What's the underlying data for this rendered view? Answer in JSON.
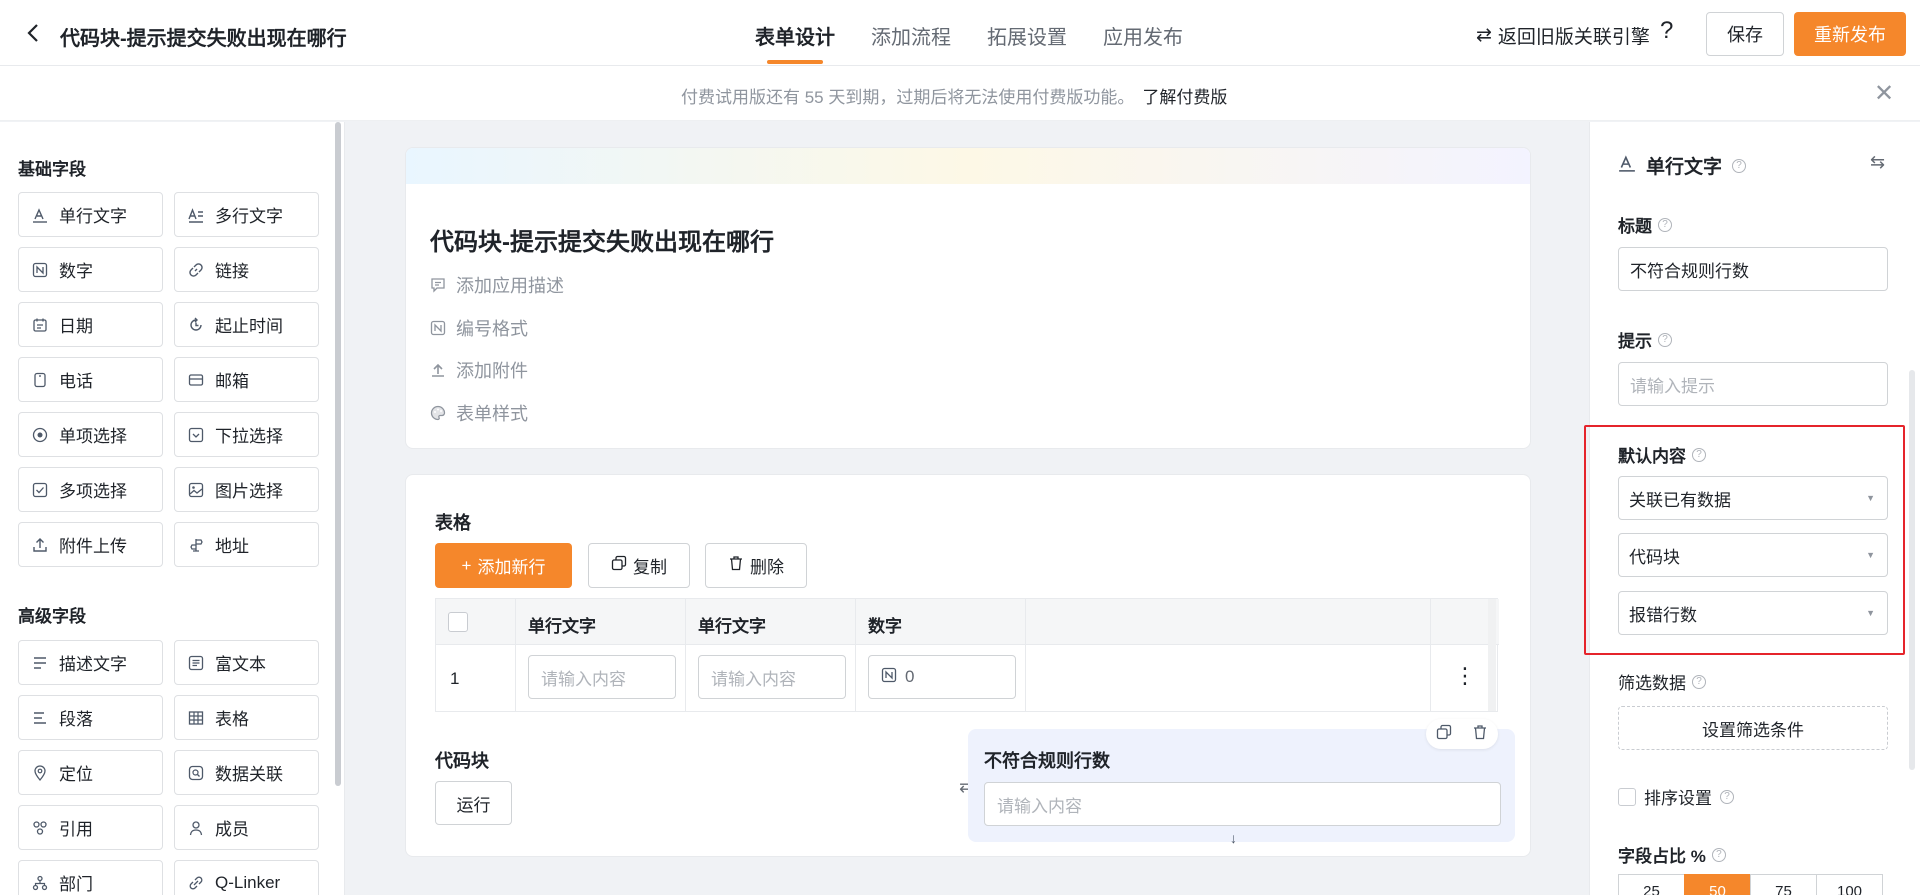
{
  "header": {
    "app_title": "代码块-提示提交失败出现在哪行",
    "tabs": [
      {
        "label": "表单设计",
        "active": true
      },
      {
        "label": "添加流程",
        "active": false
      },
      {
        "label": "拓展设置",
        "active": false
      },
      {
        "label": "应用发布",
        "active": false
      }
    ],
    "old_engine_link": "返回旧版关联引擎",
    "help": "?",
    "save_label": "保存",
    "publish_label": "重新发布"
  },
  "notice": {
    "text": "付费试用版还有 55 天到期，过期后将无法使用付费版功能。",
    "link": "了解付费版"
  },
  "left_panel": {
    "basic_title": "基础字段",
    "basic_fields": [
      {
        "label": "单行文字",
        "icon": "text-a-icon"
      },
      {
        "label": "多行文字",
        "icon": "multiline-text-icon"
      },
      {
        "label": "数字",
        "icon": "number-icon"
      },
      {
        "label": "链接",
        "icon": "link-icon"
      },
      {
        "label": "日期",
        "icon": "calendar-icon"
      },
      {
        "label": "起止时间",
        "icon": "time-range-icon"
      },
      {
        "label": "电话",
        "icon": "phone-icon"
      },
      {
        "label": "邮箱",
        "icon": "mail-icon"
      },
      {
        "label": "单项选择",
        "icon": "radio-icon"
      },
      {
        "label": "下拉选择",
        "icon": "dropdown-icon"
      },
      {
        "label": "多项选择",
        "icon": "checkbox-icon"
      },
      {
        "label": "图片选择",
        "icon": "image-icon"
      },
      {
        "label": "附件上传",
        "icon": "upload-icon"
      },
      {
        "label": "地址",
        "icon": "address-icon"
      }
    ],
    "advanced_title": "高级字段",
    "advanced_fields": [
      {
        "label": "描述文字",
        "icon": "description-icon"
      },
      {
        "label": "富文本",
        "icon": "rich-text-icon"
      },
      {
        "label": "段落",
        "icon": "paragraph-icon"
      },
      {
        "label": "表格",
        "icon": "table-icon"
      },
      {
        "label": "定位",
        "icon": "location-icon"
      },
      {
        "label": "数据关联",
        "icon": "data-link-icon"
      },
      {
        "label": "引用",
        "icon": "reference-icon"
      },
      {
        "label": "成员",
        "icon": "member-icon"
      },
      {
        "label": "部门",
        "icon": "department-icon"
      },
      {
        "label": "Q-Linker",
        "icon": "qlinker-icon"
      }
    ]
  },
  "form": {
    "title": "代码块-提示提交失败出现在哪行",
    "options": [
      {
        "label": "添加应用描述",
        "icon": "comment-icon"
      },
      {
        "label": "编号格式",
        "icon": "number-format-icon"
      },
      {
        "label": "添加附件",
        "icon": "attachment-upload-icon"
      },
      {
        "label": "表单样式",
        "icon": "palette-icon"
      }
    ],
    "table_block": {
      "label": "表格",
      "add_row": "添加新行",
      "copy": "复制",
      "delete": "删除",
      "columns": [
        "单行文字",
        "单行文字",
        "数字"
      ],
      "rows": [
        {
          "num": "1",
          "cells": [
            "请输入内容",
            "请输入内容",
            "0"
          ]
        }
      ]
    },
    "code_block": {
      "label": "代码块",
      "run": "运行"
    },
    "selected_field": {
      "label": "不符合规则行数",
      "placeholder": "请输入内容"
    }
  },
  "right_panel": {
    "field_type": "单行文字",
    "title_label": "标题",
    "title_value": "不符合规则行数",
    "hint_label": "提示",
    "hint_placeholder": "请输入提示",
    "default_label": "默认内容",
    "default_mode": "关联已有数据",
    "source_form": "代码块",
    "source_field": "报错行数",
    "filter_label": "筛选数据",
    "filter_button": "设置筛选条件",
    "sort_label": "排序设置",
    "ratio_label": "字段占比 %",
    "ratio_options": [
      "25",
      "50",
      "75",
      "100"
    ],
    "ratio_selected": "50"
  },
  "colors": {
    "accent": "#f5872b",
    "highlight_box": "#e5242b",
    "selected_field_bg": "#eef2fd"
  }
}
